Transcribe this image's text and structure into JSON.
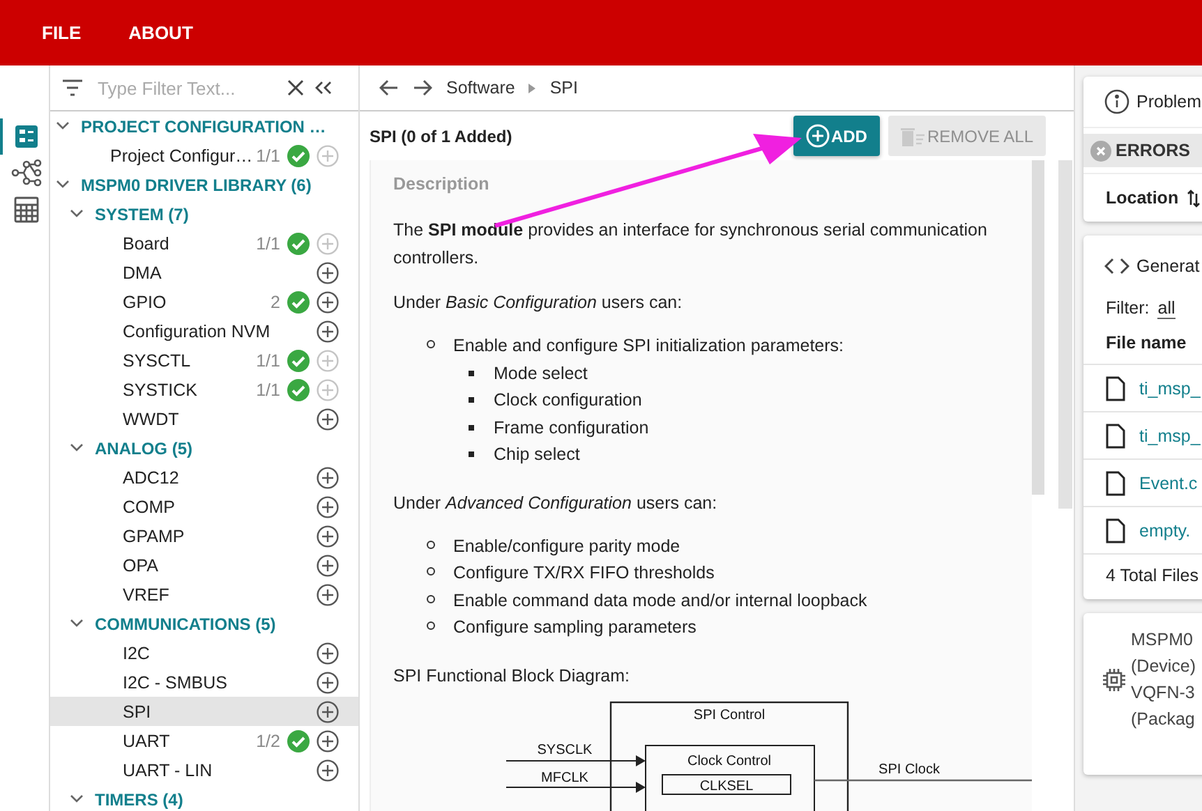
{
  "menu": [
    "FILE",
    "ABOUT"
  ],
  "rail": [
    {
      "kind": "list",
      "selected": true
    },
    {
      "kind": "network",
      "selected": false
    },
    {
      "kind": "calculator",
      "selected": false
    }
  ],
  "filter": {
    "placeholder": "Type Filter Text..."
  },
  "tree": [
    {
      "kind": "group",
      "label": "PROJECT CONFIGURATION …",
      "expanded": true,
      "children": [
        {
          "kind": "module",
          "label": "Project Configur…",
          "count": "1/1",
          "ok": true,
          "add_enabled": false,
          "selected": false
        }
      ]
    },
    {
      "kind": "group",
      "label": "MSPM0 DRIVER LIBRARY (6)",
      "expanded": true,
      "children": [
        {
          "kind": "group",
          "label": "SYSTEM (7)",
          "expanded": true,
          "children": [
            {
              "kind": "module",
              "label": "Board",
              "count": "1/1",
              "ok": true,
              "add_enabled": false,
              "selected": false
            },
            {
              "kind": "module",
              "label": "DMA",
              "ok": false,
              "add_enabled": true,
              "selected": false
            },
            {
              "kind": "module",
              "label": "GPIO",
              "count": "2",
              "ok": true,
              "add_enabled": true,
              "selected": false
            },
            {
              "kind": "module",
              "label": "Configuration NVM",
              "ok": false,
              "add_enabled": true,
              "selected": false
            },
            {
              "kind": "module",
              "label": "SYSCTL",
              "count": "1/1",
              "ok": true,
              "add_enabled": false,
              "selected": false
            },
            {
              "kind": "module",
              "label": "SYSTICK",
              "count": "1/1",
              "ok": true,
              "add_enabled": false,
              "selected": false
            },
            {
              "kind": "module",
              "label": "WWDT",
              "ok": false,
              "add_enabled": true,
              "selected": false
            }
          ]
        },
        {
          "kind": "group",
          "label": "ANALOG (5)",
          "expanded": true,
          "children": [
            {
              "kind": "module",
              "label": "ADC12",
              "ok": false,
              "add_enabled": true,
              "selected": false
            },
            {
              "kind": "module",
              "label": "COMP",
              "ok": false,
              "add_enabled": true,
              "selected": false
            },
            {
              "kind": "module",
              "label": "GPAMP",
              "ok": false,
              "add_enabled": true,
              "selected": false
            },
            {
              "kind": "module",
              "label": "OPA",
              "ok": false,
              "add_enabled": true,
              "selected": false
            },
            {
              "kind": "module",
              "label": "VREF",
              "ok": false,
              "add_enabled": true,
              "selected": false
            }
          ]
        },
        {
          "kind": "group",
          "label": "COMMUNICATIONS (5)",
          "expanded": true,
          "children": [
            {
              "kind": "module",
              "label": "I2C",
              "ok": false,
              "add_enabled": true,
              "selected": false
            },
            {
              "kind": "module",
              "label": "I2C - SMBUS",
              "ok": false,
              "add_enabled": true,
              "selected": false
            },
            {
              "kind": "module",
              "label": "SPI",
              "ok": false,
              "add_enabled": true,
              "selected": true
            },
            {
              "kind": "module",
              "label": "UART",
              "count": "1/2",
              "ok": true,
              "add_enabled": true,
              "selected": false
            },
            {
              "kind": "module",
              "label": "UART - LIN",
              "ok": false,
              "add_enabled": true,
              "selected": false
            }
          ]
        },
        {
          "kind": "group",
          "label": "TIMERS (4)",
          "expanded": true
        }
      ]
    }
  ],
  "breadcrumb": [
    "Software",
    "SPI"
  ],
  "title": "SPI (0 of 1 Added)",
  "buttons": [
    {
      "kind": "add",
      "label": "ADD",
      "disabled": false
    },
    {
      "kind": "remove",
      "label": "REMOVE ALL",
      "disabled": true
    }
  ],
  "description": {
    "heading": "Description",
    "blocks": [
      {
        "kind": "para",
        "lines": [
          "The **SPI module** provides an interface for synchronous serial communication",
          "controllers."
        ]
      },
      {
        "kind": "para",
        "lines": [
          "Under *Basic Configuration* users can:"
        ]
      },
      {
        "kind": "list",
        "items": [
          {
            "text": "Enable and configure SPI initialization parameters:",
            "children": [
              "Mode select",
              "Clock configuration",
              "Frame configuration",
              "Chip select"
            ]
          }
        ]
      },
      {
        "kind": "para",
        "lines": [
          "Under *Advanced Configuration* users can:"
        ]
      },
      {
        "kind": "list",
        "items": [
          {
            "text": "Enable/configure parity mode"
          },
          {
            "text": "Configure TX/RX FIFO thresholds"
          },
          {
            "text": "Enable command data mode and/or internal loopback"
          },
          {
            "text": "Configure sampling parameters"
          }
        ]
      },
      {
        "kind": "para",
        "lines": [
          "SPI Functional Block Diagram:"
        ]
      }
    ],
    "diagram": {
      "title": "SPI Control",
      "inputs": [
        "SYSCLK",
        "MFCLK"
      ],
      "block": "Clock Control",
      "register": "CLKSEL",
      "output": "SPI Clock"
    }
  },
  "problems": {
    "title": "Problem",
    "chip": "ERRORS",
    "column": "Location"
  },
  "generated": {
    "title": "Generat",
    "filter_label": "Filter:",
    "filter_value": "all",
    "column": "File name",
    "files": [
      "ti_msp_",
      "ti_msp_",
      "Event.c",
      "empty."
    ],
    "total": "4 Total Files"
  },
  "device": {
    "lines": [
      "MSPM0",
      "(Device)",
      "VQFN-3",
      "(Packag"
    ]
  }
}
